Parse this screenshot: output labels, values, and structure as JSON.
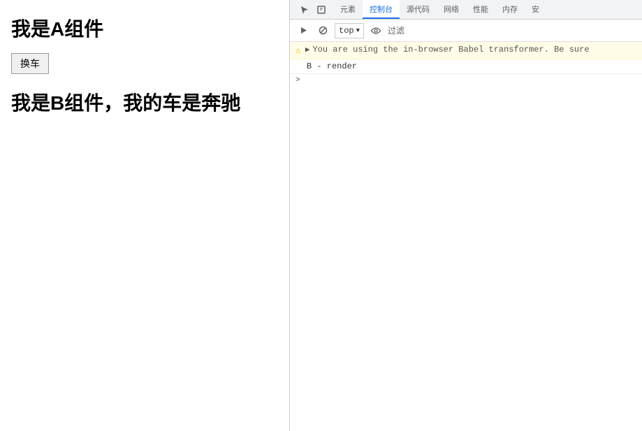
{
  "app": {
    "component_a_title": "我是A组件",
    "change_car_button": "换车",
    "component_b_text": "我是B组件，我的车是奔驰"
  },
  "devtools": {
    "tabs": [
      {
        "label": "元素",
        "active": false
      },
      {
        "label": "控制台",
        "active": true
      },
      {
        "label": "源代码",
        "active": false
      },
      {
        "label": "网络",
        "active": false
      },
      {
        "label": "性能",
        "active": false
      },
      {
        "label": "内存",
        "active": false
      },
      {
        "label": "安",
        "active": false
      }
    ],
    "toolbar": {
      "top_selector": "top",
      "filter_label": "过滤"
    },
    "console": {
      "warning_text": "You are using the in-browser Babel transformer. Be sure",
      "log_entry": "B - render",
      "expand_arrow": ">"
    }
  }
}
